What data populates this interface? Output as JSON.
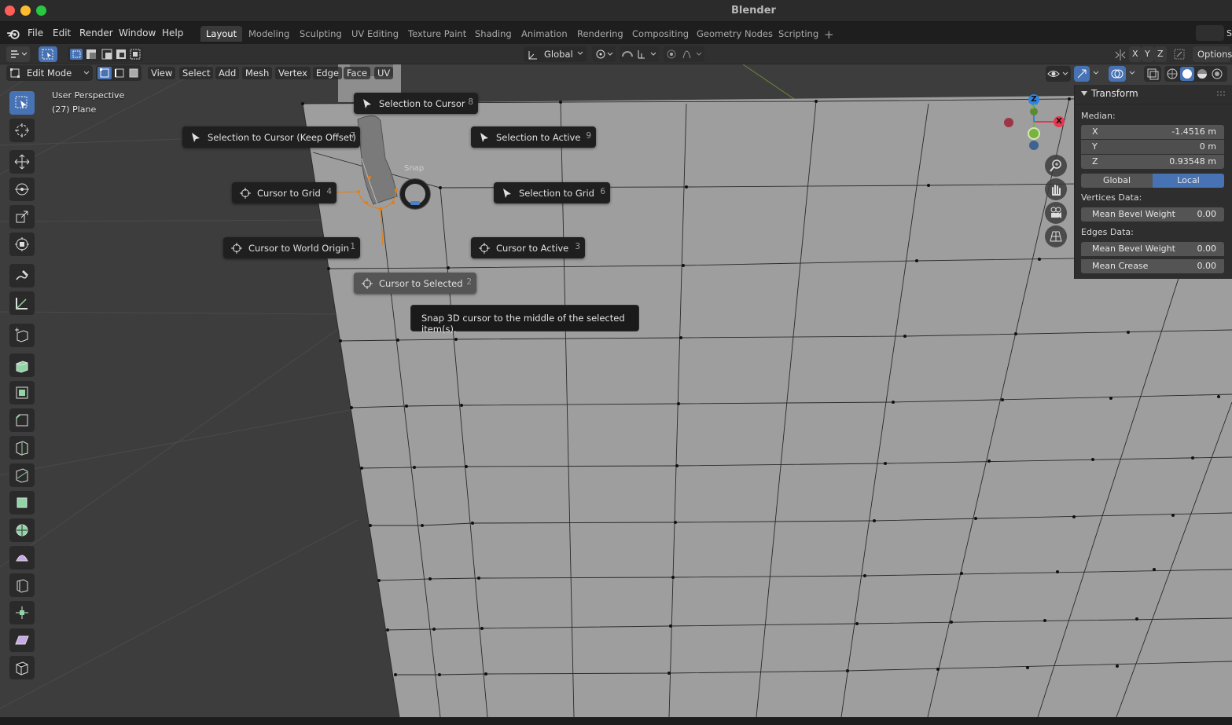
{
  "app": {
    "title": "Blender"
  },
  "menu": {
    "items": [
      "File",
      "Edit",
      "Render",
      "Window",
      "Help"
    ]
  },
  "workspaces": {
    "tabs": [
      "Layout",
      "Modeling",
      "Sculpting",
      "UV Editing",
      "Texture Paint",
      "Shading",
      "Animation",
      "Rendering",
      "Compositing",
      "Geometry Nodes",
      "Scripting"
    ],
    "active": "Layout",
    "scene_partial": "S"
  },
  "tool_header": {
    "transform_orientation": "Global",
    "axes": [
      "X",
      "Y",
      "Z"
    ],
    "options_label": "Options"
  },
  "edit_header": {
    "mode": "Edit Mode",
    "menus": [
      "View",
      "Select",
      "Add",
      "Mesh",
      "Vertex",
      "Edge",
      "Face",
      "UV"
    ]
  },
  "viewport": {
    "perspective": "User Perspective",
    "object": "(27) Plane"
  },
  "pie_menu": {
    "title": "Snap",
    "items": [
      {
        "label": "Selection to Cursor",
        "key": "8",
        "icon": "cursor-arrow-icon"
      },
      {
        "label": "Selection to Cursor (Keep Offset)",
        "key": "7",
        "icon": "cursor-arrow-icon"
      },
      {
        "label": "Selection to Active",
        "key": "9",
        "icon": "cursor-arrow-icon"
      },
      {
        "label": "Cursor to Grid",
        "key": "4",
        "icon": "3d-cursor-icon"
      },
      {
        "label": "Selection to Grid",
        "key": "6",
        "icon": "cursor-arrow-icon"
      },
      {
        "label": "Cursor to World Origin",
        "key": "1",
        "icon": "3d-cursor-icon"
      },
      {
        "label": "Cursor to Active",
        "key": "3",
        "icon": "3d-cursor-icon"
      },
      {
        "label": "Cursor to Selected",
        "key": "2",
        "icon": "3d-cursor-icon"
      }
    ],
    "hovered": "Cursor to Selected",
    "tooltip": "Snap 3D cursor to the middle of the selected item(s)."
  },
  "gizmo": {
    "x": "X",
    "y": "Y",
    "z": "Z",
    "colors": {
      "x": "#e8364f",
      "y": "#7ab23f",
      "z": "#2f83e3"
    }
  },
  "npanel": {
    "header": "Transform",
    "median_label": "Median:",
    "fields": [
      {
        "axis": "X",
        "value": "-1.4516 m"
      },
      {
        "axis": "Y",
        "value": "0 m"
      },
      {
        "axis": "Z",
        "value": "0.93548 m"
      }
    ],
    "toggle": {
      "global": "Global",
      "local": "Local",
      "active": "Local"
    },
    "vertices_label": "Vertices Data:",
    "vertices_fields": [
      {
        "label": "Mean Bevel Weight",
        "value": "0.00"
      }
    ],
    "edges_label": "Edges Data:",
    "edges_fields": [
      {
        "label": "Mean Bevel Weight",
        "value": "0.00"
      },
      {
        "label": "Mean Crease",
        "value": "0.00"
      }
    ]
  },
  "colors": {
    "accent": "#4772b3",
    "selection": "#e87d0d",
    "menu_bg": "#1f1f1f"
  }
}
